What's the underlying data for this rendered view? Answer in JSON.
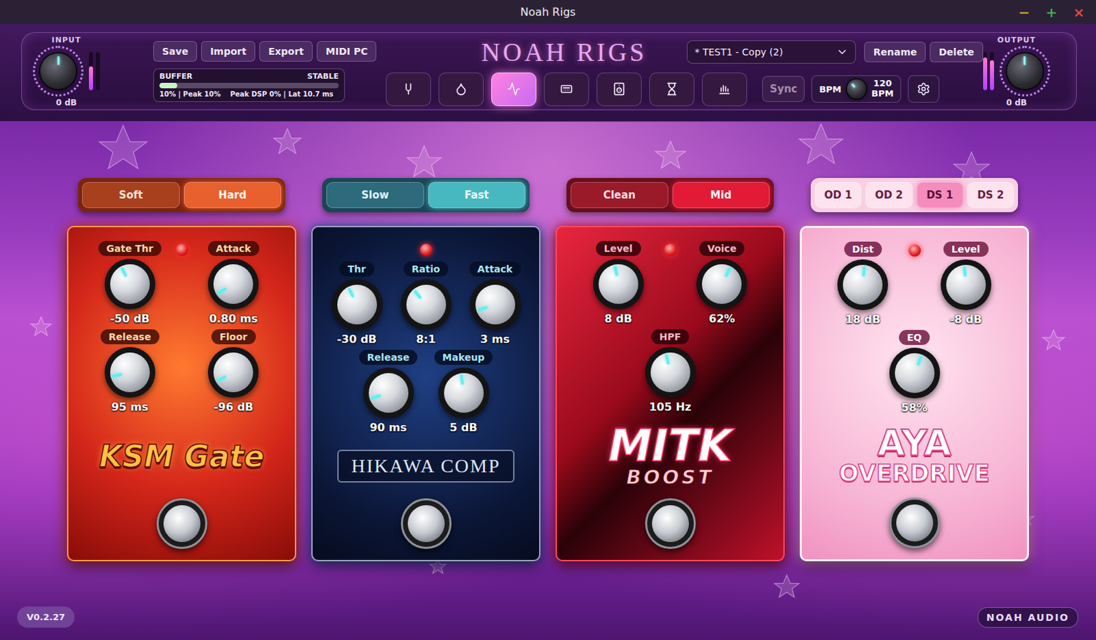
{
  "window": {
    "title": "Noah Rigs",
    "controls": [
      {
        "label": "−",
        "color": "#c9a227"
      },
      {
        "label": "+",
        "color": "#3fae4a"
      },
      {
        "label": "×",
        "color": "#e0443e"
      }
    ]
  },
  "input": {
    "label": "INPUT",
    "reading": "0 dB",
    "level": 0.5,
    "meters": [
      0.62,
      0.0
    ]
  },
  "output": {
    "label": "OUTPUT",
    "reading": "0 dB",
    "level": 0.5,
    "meters": [
      0.85,
      0.78
    ]
  },
  "actions": [
    "Save",
    "Import",
    "Export",
    "MIDI PC"
  ],
  "buffer": {
    "label": "BUFFER",
    "status": "STABLE",
    "level": 0.1,
    "stats": [
      "10% | Peak 10%",
      "Peak DSP 0% | Lat 10.7 ms"
    ]
  },
  "logo": "NOAH RIGS",
  "view_tabs": [
    {
      "selected": false
    },
    {
      "selected": false
    },
    {
      "selected": true
    },
    {
      "selected": false
    },
    {
      "selected": false
    },
    {
      "selected": false
    },
    {
      "selected": false
    }
  ],
  "preset": {
    "value": "* TEST1 - Copy (2)"
  },
  "preset_actions": [
    "Rename",
    "Delete"
  ],
  "sync": {
    "label": "Sync",
    "on": false
  },
  "bpm": {
    "label": "BPM",
    "level": 0.35,
    "value": "120",
    "unit": "BPM"
  },
  "pedals": [
    {
      "kind": "gate",
      "color": "#d8321c",
      "led_on": true,
      "logo": [
        "KSM Gate"
      ],
      "modes": [
        {
          "label": "Soft",
          "selected": false
        },
        {
          "label": "Hard",
          "selected": true
        }
      ],
      "rows": [
        [
          {
            "label": "Gate Thr",
            "value": "-50 dB",
            "level": 0.4
          },
          {
            "label": "Attack",
            "value": "0.80 ms",
            "level": 0.05
          }
        ],
        [
          {
            "label": "Release",
            "value": "95 ms",
            "level": 0.12
          },
          {
            "label": "Floor",
            "value": "-96 dB",
            "level": 0.06
          }
        ]
      ]
    },
    {
      "kind": "comp",
      "color": "#2a4fa0",
      "led_on": true,
      "logo": [
        "HIKAWA COMP"
      ],
      "modes": [
        {
          "label": "Slow",
          "selected": false
        },
        {
          "label": "Fast",
          "selected": true
        }
      ],
      "rows": [
        [
          {
            "label": "Thr",
            "value": "-30 dB",
            "level": 0.4
          },
          {
            "label": "Ratio",
            "value": "8:1",
            "level": 0.35
          },
          {
            "label": "Attack",
            "value": "3 ms",
            "level": 0.1
          }
        ],
        [
          {
            "label": "Release",
            "value": "90 ms",
            "level": 0.1
          },
          {
            "label": "Makeup",
            "value": "5 dB",
            "level": 0.47
          }
        ]
      ]
    },
    {
      "kind": "mitk",
      "color": "#c8102e",
      "led_on": true,
      "logo": [
        "MITK",
        "BOOST"
      ],
      "modes": [
        {
          "label": "Clean",
          "selected": false
        },
        {
          "label": "Mid",
          "selected": true
        }
      ],
      "rows": [
        [
          {
            "label": "Level",
            "value": "8 dB",
            "level": 0.46
          },
          {
            "label": "Voice",
            "value": "62%",
            "level": 0.6
          }
        ],
        [
          {
            "label": "HPF",
            "value": "105 Hz",
            "level": 0.45
          }
        ]
      ]
    },
    {
      "kind": "aya",
      "color": "#f39cc6",
      "led_on": true,
      "logo": [
        "AYA",
        "OVERDRIVE"
      ],
      "modes": [
        {
          "label": "OD 1",
          "selected": false
        },
        {
          "label": "OD 2",
          "selected": false
        },
        {
          "label": "DS 1",
          "selected": true
        },
        {
          "label": "DS 2",
          "selected": false
        }
      ],
      "rows": [
        [
          {
            "label": "Dist",
            "value": "18 dB",
            "level": 0.52
          },
          {
            "label": "Level",
            "value": "-8 dB",
            "level": 0.48
          }
        ],
        [
          {
            "label": "EQ",
            "value": "58%",
            "level": 0.58
          }
        ]
      ]
    }
  ],
  "footer": {
    "version": "V0.2.27",
    "brand": "NOAH AUDIO"
  }
}
